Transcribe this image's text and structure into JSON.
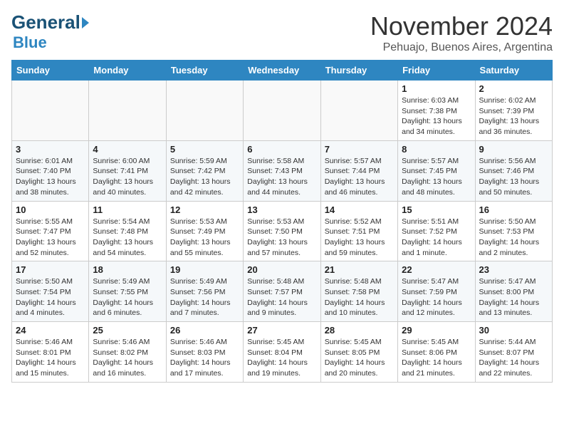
{
  "header": {
    "logo_general": "General",
    "logo_blue": "Blue",
    "month": "November 2024",
    "location": "Pehuajo, Buenos Aires, Argentina"
  },
  "weekdays": [
    "Sunday",
    "Monday",
    "Tuesday",
    "Wednesday",
    "Thursday",
    "Friday",
    "Saturday"
  ],
  "weeks": [
    [
      {
        "day": "",
        "info": ""
      },
      {
        "day": "",
        "info": ""
      },
      {
        "day": "",
        "info": ""
      },
      {
        "day": "",
        "info": ""
      },
      {
        "day": "",
        "info": ""
      },
      {
        "day": "1",
        "info": "Sunrise: 6:03 AM\nSunset: 7:38 PM\nDaylight: 13 hours\nand 34 minutes."
      },
      {
        "day": "2",
        "info": "Sunrise: 6:02 AM\nSunset: 7:39 PM\nDaylight: 13 hours\nand 36 minutes."
      }
    ],
    [
      {
        "day": "3",
        "info": "Sunrise: 6:01 AM\nSunset: 7:40 PM\nDaylight: 13 hours\nand 38 minutes."
      },
      {
        "day": "4",
        "info": "Sunrise: 6:00 AM\nSunset: 7:41 PM\nDaylight: 13 hours\nand 40 minutes."
      },
      {
        "day": "5",
        "info": "Sunrise: 5:59 AM\nSunset: 7:42 PM\nDaylight: 13 hours\nand 42 minutes."
      },
      {
        "day": "6",
        "info": "Sunrise: 5:58 AM\nSunset: 7:43 PM\nDaylight: 13 hours\nand 44 minutes."
      },
      {
        "day": "7",
        "info": "Sunrise: 5:57 AM\nSunset: 7:44 PM\nDaylight: 13 hours\nand 46 minutes."
      },
      {
        "day": "8",
        "info": "Sunrise: 5:57 AM\nSunset: 7:45 PM\nDaylight: 13 hours\nand 48 minutes."
      },
      {
        "day": "9",
        "info": "Sunrise: 5:56 AM\nSunset: 7:46 PM\nDaylight: 13 hours\nand 50 minutes."
      }
    ],
    [
      {
        "day": "10",
        "info": "Sunrise: 5:55 AM\nSunset: 7:47 PM\nDaylight: 13 hours\nand 52 minutes."
      },
      {
        "day": "11",
        "info": "Sunrise: 5:54 AM\nSunset: 7:48 PM\nDaylight: 13 hours\nand 54 minutes."
      },
      {
        "day": "12",
        "info": "Sunrise: 5:53 AM\nSunset: 7:49 PM\nDaylight: 13 hours\nand 55 minutes."
      },
      {
        "day": "13",
        "info": "Sunrise: 5:53 AM\nSunset: 7:50 PM\nDaylight: 13 hours\nand 57 minutes."
      },
      {
        "day": "14",
        "info": "Sunrise: 5:52 AM\nSunset: 7:51 PM\nDaylight: 13 hours\nand 59 minutes."
      },
      {
        "day": "15",
        "info": "Sunrise: 5:51 AM\nSunset: 7:52 PM\nDaylight: 14 hours\nand 1 minute."
      },
      {
        "day": "16",
        "info": "Sunrise: 5:50 AM\nSunset: 7:53 PM\nDaylight: 14 hours\nand 2 minutes."
      }
    ],
    [
      {
        "day": "17",
        "info": "Sunrise: 5:50 AM\nSunset: 7:54 PM\nDaylight: 14 hours\nand 4 minutes."
      },
      {
        "day": "18",
        "info": "Sunrise: 5:49 AM\nSunset: 7:55 PM\nDaylight: 14 hours\nand 6 minutes."
      },
      {
        "day": "19",
        "info": "Sunrise: 5:49 AM\nSunset: 7:56 PM\nDaylight: 14 hours\nand 7 minutes."
      },
      {
        "day": "20",
        "info": "Sunrise: 5:48 AM\nSunset: 7:57 PM\nDaylight: 14 hours\nand 9 minutes."
      },
      {
        "day": "21",
        "info": "Sunrise: 5:48 AM\nSunset: 7:58 PM\nDaylight: 14 hours\nand 10 minutes."
      },
      {
        "day": "22",
        "info": "Sunrise: 5:47 AM\nSunset: 7:59 PM\nDaylight: 14 hours\nand 12 minutes."
      },
      {
        "day": "23",
        "info": "Sunrise: 5:47 AM\nSunset: 8:00 PM\nDaylight: 14 hours\nand 13 minutes."
      }
    ],
    [
      {
        "day": "24",
        "info": "Sunrise: 5:46 AM\nSunset: 8:01 PM\nDaylight: 14 hours\nand 15 minutes."
      },
      {
        "day": "25",
        "info": "Sunrise: 5:46 AM\nSunset: 8:02 PM\nDaylight: 14 hours\nand 16 minutes."
      },
      {
        "day": "26",
        "info": "Sunrise: 5:46 AM\nSunset: 8:03 PM\nDaylight: 14 hours\nand 17 minutes."
      },
      {
        "day": "27",
        "info": "Sunrise: 5:45 AM\nSunset: 8:04 PM\nDaylight: 14 hours\nand 19 minutes."
      },
      {
        "day": "28",
        "info": "Sunrise: 5:45 AM\nSunset: 8:05 PM\nDaylight: 14 hours\nand 20 minutes."
      },
      {
        "day": "29",
        "info": "Sunrise: 5:45 AM\nSunset: 8:06 PM\nDaylight: 14 hours\nand 21 minutes."
      },
      {
        "day": "30",
        "info": "Sunrise: 5:44 AM\nSunset: 8:07 PM\nDaylight: 14 hours\nand 22 minutes."
      }
    ]
  ]
}
